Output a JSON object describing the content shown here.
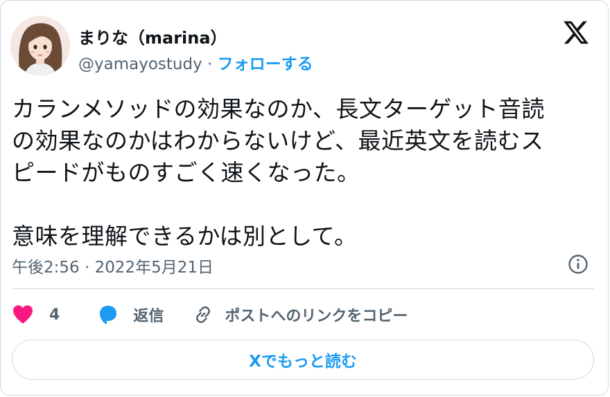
{
  "author": {
    "display_name": "まりな（marina）",
    "handle": "@yamayostudy",
    "separator": " · ",
    "follow_label": "フォローする"
  },
  "tweet": {
    "text": "カランメソッドの効果なのか、長文ターゲット音読\nの効果なのかはわからないけど、最近英文を読むス\nピードがものすごく速くなった。\n\n意味を理解できるかは別として。",
    "timestamp": "午後2:56 · 2022年5月21日"
  },
  "actions": {
    "like_count": "4",
    "reply_label": "返信",
    "copy_link_label": "ポストへのリンクをコピー"
  },
  "read_more_label": "Xでもっと読む",
  "colors": {
    "accent": "#1d9bf0",
    "like": "#f91880",
    "text": "#0f1419",
    "secondary": "#536471",
    "border": "#cfd9de"
  },
  "icons": {
    "logo": "x-logo-icon",
    "info": "info-icon",
    "like": "heart-icon",
    "reply": "speech-bubble-icon",
    "copy": "link-icon"
  }
}
